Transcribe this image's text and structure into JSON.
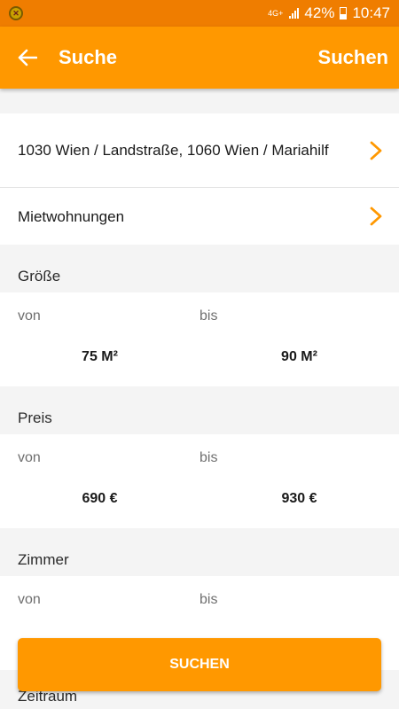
{
  "status": {
    "network": "4G+",
    "battery": "42%",
    "time": "10:47"
  },
  "app_bar": {
    "title": "Suche",
    "action": "Suchen"
  },
  "location": {
    "label": "1030 Wien / Landstraße, 1060 Wien / Mariahilf"
  },
  "category": {
    "label": "Mietwohnungen"
  },
  "sections": {
    "size": {
      "title": "Größe",
      "from_label": "von",
      "to_label": "bis",
      "from_value": "75 M²",
      "to_value": "90 M²"
    },
    "price": {
      "title": "Preis",
      "from_label": "von",
      "to_label": "bis",
      "from_value": "690 €",
      "to_value": "930 €"
    },
    "rooms": {
      "title": "Zimmer",
      "from_label": "von",
      "to_label": "bis"
    },
    "period": {
      "title": "Zeitraum"
    }
  },
  "search_button": {
    "label": "SUCHEN"
  },
  "colors": {
    "status_bar": "#ef7d00",
    "accent": "#ff9800",
    "background": "#f4f4f4"
  }
}
